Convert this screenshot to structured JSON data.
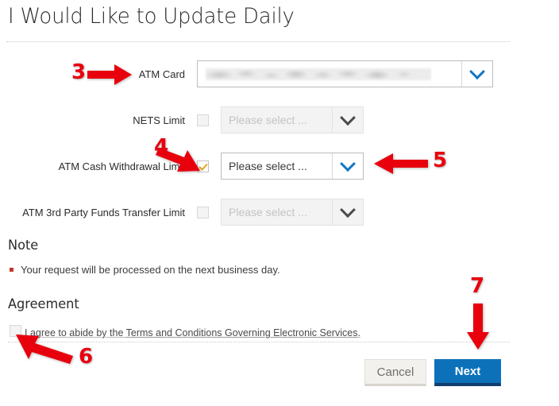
{
  "page": {
    "title": "I Would Like to Update Daily"
  },
  "form": {
    "rows": [
      {
        "label": "ATM Card",
        "has_checkbox": false,
        "checked": false,
        "value": "",
        "redacted": true,
        "disabled": false,
        "chevron": "chevron-down-icon"
      },
      {
        "label": "NETS Limit",
        "has_checkbox": true,
        "checked": false,
        "value": "Please select ...",
        "redacted": false,
        "disabled": true,
        "chevron": "chevron-down-icon"
      },
      {
        "label": "ATM Cash Withdrawal Limit",
        "has_checkbox": true,
        "checked": true,
        "value": "Please select ...",
        "redacted": false,
        "disabled": false,
        "chevron": "chevron-down-icon"
      },
      {
        "label": "ATM 3rd Party Funds Transfer Limit",
        "has_checkbox": true,
        "checked": false,
        "value": "Please select ...",
        "redacted": false,
        "disabled": true,
        "chevron": "chevron-down-icon"
      }
    ]
  },
  "note": {
    "heading": "Note",
    "items": [
      "Your request will be processed on the next business day."
    ]
  },
  "agreement": {
    "heading": "Agreement",
    "checked": false,
    "text_before": "I agree to abide by the ",
    "link_text": "Terms and Conditions Governing Electronic Services",
    "text_after": "."
  },
  "buttons": {
    "cancel_label": "Cancel",
    "next_label": "Next"
  },
  "annotations": {
    "markers": [
      {
        "number": "3",
        "points_to": "atm-card-label",
        "direction": "right"
      },
      {
        "number": "4",
        "points_to": "atm-cash-withdrawal-checkbox",
        "direction": "down-right"
      },
      {
        "number": "5",
        "points_to": "atm-cash-withdrawal-select",
        "direction": "left"
      },
      {
        "number": "6",
        "points_to": "agreement-checkbox",
        "direction": "up-left"
      },
      {
        "number": "7",
        "points_to": "next-button",
        "direction": "down"
      }
    ]
  },
  "colors": {
    "accent_blue": "#0d71ba",
    "annotation_red": "#e8000d",
    "check_amber": "#e8a320",
    "bullet_red": "#c0392b"
  }
}
